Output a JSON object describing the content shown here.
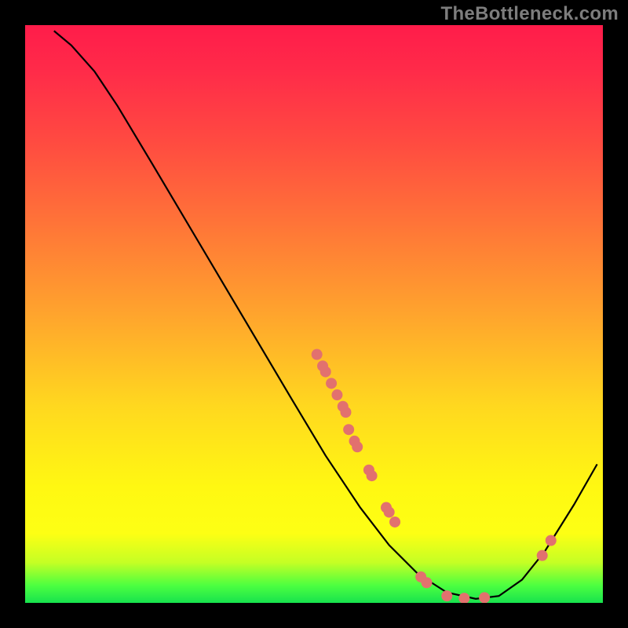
{
  "attribution": "TheBottleneck.com",
  "chart_data": {
    "type": "line",
    "title": "",
    "xlabel": "",
    "ylabel": "",
    "xlim": [
      0,
      100
    ],
    "ylim": [
      0,
      100
    ],
    "curve": {
      "name": "bottleneck-curve",
      "points": [
        {
          "x": 5.0,
          "y": 99.0
        },
        {
          "x": 8.0,
          "y": 96.5
        },
        {
          "x": 12.0,
          "y": 92.0
        },
        {
          "x": 16.0,
          "y": 86.0
        },
        {
          "x": 22.0,
          "y": 76.0
        },
        {
          "x": 30.0,
          "y": 62.5
        },
        {
          "x": 38.0,
          "y": 49.0
        },
        {
          "x": 46.0,
          "y": 35.5
        },
        {
          "x": 52.0,
          "y": 25.5
        },
        {
          "x": 58.0,
          "y": 16.5
        },
        {
          "x": 63.0,
          "y": 10.0
        },
        {
          "x": 68.0,
          "y": 5.0
        },
        {
          "x": 73.0,
          "y": 1.8
        },
        {
          "x": 78.0,
          "y": 0.7
        },
        {
          "x": 82.0,
          "y": 1.2
        },
        {
          "x": 86.0,
          "y": 4.0
        },
        {
          "x": 90.0,
          "y": 9.0
        },
        {
          "x": 95.0,
          "y": 17.0
        },
        {
          "x": 99.0,
          "y": 24.0
        }
      ]
    },
    "scatter": {
      "name": "markers",
      "points": [
        {
          "x": 50.5,
          "y": 43.0
        },
        {
          "x": 51.5,
          "y": 41.0
        },
        {
          "x": 52.0,
          "y": 40.0
        },
        {
          "x": 53.0,
          "y": 38.0
        },
        {
          "x": 54.0,
          "y": 36.0
        },
        {
          "x": 55.0,
          "y": 34.0
        },
        {
          "x": 55.5,
          "y": 33.0
        },
        {
          "x": 56.0,
          "y": 30.0
        },
        {
          "x": 57.0,
          "y": 28.0
        },
        {
          "x": 57.5,
          "y": 27.0
        },
        {
          "x": 59.5,
          "y": 23.0
        },
        {
          "x": 60.0,
          "y": 22.0
        },
        {
          "x": 62.5,
          "y": 16.5
        },
        {
          "x": 63.0,
          "y": 15.7
        },
        {
          "x": 64.0,
          "y": 14.0
        },
        {
          "x": 68.5,
          "y": 4.5
        },
        {
          "x": 69.5,
          "y": 3.5
        },
        {
          "x": 73.0,
          "y": 1.2
        },
        {
          "x": 76.0,
          "y": 0.8
        },
        {
          "x": 79.5,
          "y": 0.9
        },
        {
          "x": 89.5,
          "y": 8.2
        },
        {
          "x": 91.0,
          "y": 10.8
        }
      ]
    },
    "marker_color": "#e2716e",
    "curve_color": "#000000"
  }
}
